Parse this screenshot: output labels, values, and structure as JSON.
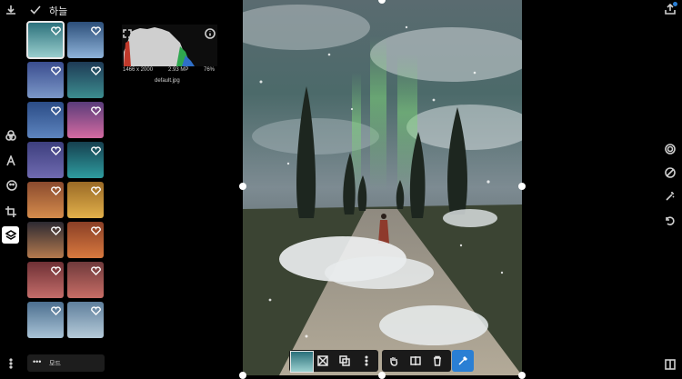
{
  "topbar": {
    "title": "하늘"
  },
  "histogram": {
    "dimensions": "1466 x 2000",
    "megapixels": "2.93 MP",
    "zoom": "76%",
    "filename": "default.jpg"
  },
  "mode": {
    "label": "모드"
  },
  "thumbnails": [
    {
      "c1": "#2a6f7a",
      "c2": "#9bd0cf",
      "selected": true
    },
    {
      "c1": "#2c4f7a",
      "c2": "#8fb3d9",
      "selected": false
    },
    {
      "c1": "#3a4d8f",
      "c2": "#7b97c7",
      "selected": false
    },
    {
      "c1": "#1e3a55",
      "c2": "#3c8d8f",
      "selected": false
    },
    {
      "c1": "#2b4c86",
      "c2": "#5d84be",
      "selected": false
    },
    {
      "c1": "#5a3c7a",
      "c2": "#d46aa1",
      "selected": false
    },
    {
      "c1": "#3d3f7e",
      "c2": "#6f6ab0",
      "selected": false
    },
    {
      "c1": "#16404f",
      "c2": "#2e9c9f",
      "selected": false
    },
    {
      "c1": "#8a4a2e",
      "c2": "#d58c4c",
      "selected": false
    },
    {
      "c1": "#9a6a26",
      "c2": "#e2b04a",
      "selected": false
    },
    {
      "c1": "#2d2a32",
      "c2": "#b47a4e",
      "selected": false
    },
    {
      "c1": "#8a3f26",
      "c2": "#d8793f",
      "selected": false
    },
    {
      "c1": "#6e3035",
      "c2": "#c46d6a",
      "selected": false
    },
    {
      "c1": "#6f3a3b",
      "c2": "#c86d66",
      "selected": false
    },
    {
      "c1": "#4c6f8f",
      "c2": "#a9c3d6",
      "selected": false
    },
    {
      "c1": "#5f7f9c",
      "c2": "#b6cbd9",
      "selected": false
    }
  ],
  "colors": {
    "accent": "#2a7fd4",
    "background": "#000000"
  },
  "icons": [
    "download-icon",
    "check-icon",
    "info-icon",
    "share-icon",
    "dots-icon",
    "layers-icon",
    "crop-icon",
    "text-icon",
    "color-icon",
    "face-icon",
    "undo-icon"
  ]
}
